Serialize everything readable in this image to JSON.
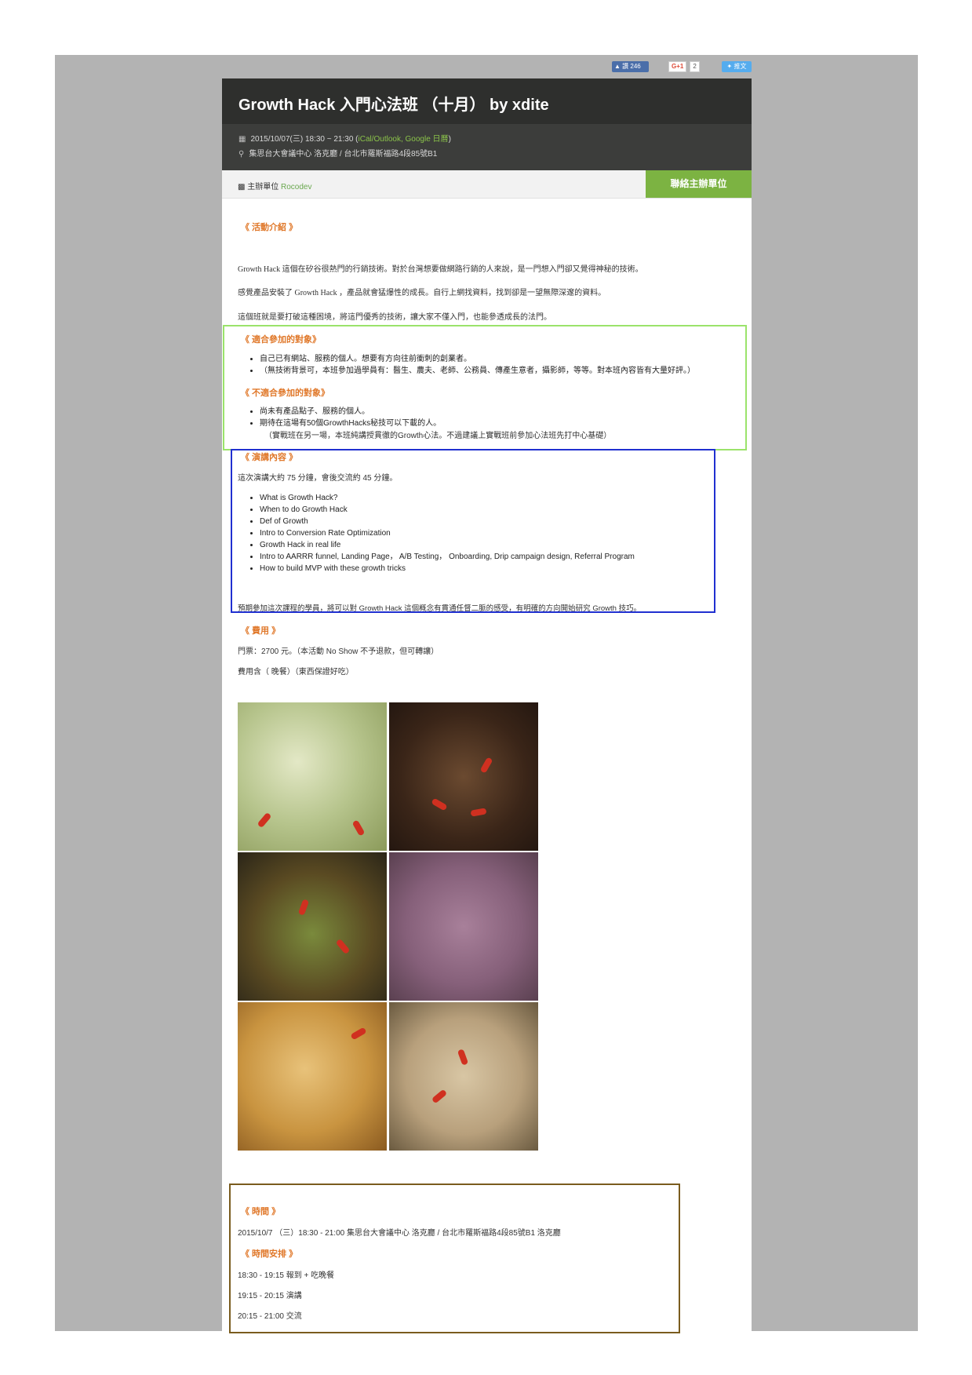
{
  "share": {
    "like_label": "讚 246",
    "gplus_label": "G+1",
    "gplus_count": "2",
    "tweet_label": "推文"
  },
  "event": {
    "title": "Growth Hack 入門心法班 （十月） by xdite",
    "datetime": "2015/10/07(三) 18:30 ~ 21:30 (",
    "calendar_links": "iCal/Outlook, Google 日曆",
    "datetime_close": ")",
    "location": "集思台大會議中心 洛克廳 / 台北市羅斯福路4段85號B1"
  },
  "organizer": {
    "label": "主辦單位",
    "name": "Rocodev",
    "contact_button": "聯絡主辦單位"
  },
  "intro": {
    "heading": "《 活動介紹 》",
    "paragraphs": [
      "Growth Hack 這個在矽谷很熱門的行銷技術。對於台灣想要做網路行銷的人來說，是一門想入門卻又覺得神秘的技術。",
      "感覺產品安裝了 Growth Hack ，產品就會猛爆性的成長。自行上網找資料，找到卻是一望無際深邃的資料。",
      "這個班就是要打破這種困境，將這門優秀的技術，讓大家不僅入門，也能參透成長的法門。"
    ]
  },
  "suitable": {
    "heading": "《 適合參加的對象》",
    "items": [
      "自己已有網站、服務的個人。想要有方向往前衝刺的創業者。",
      "（無技術背景可，本班參加過學員有：醫生、農夫、老師、公務員、傳產生意者，攝影師，等等。對本班內容皆有大量好評。）"
    ]
  },
  "unsuitable": {
    "heading": "《 不適合參加的對象》",
    "items": [
      "尚未有產品點子、服務的個人。",
      "期待在這場有50個GrowthHacks秘技可以下載的人。"
    ],
    "note": "（實戰班在另一場，本班純講授貫徹的Growth心法。不過建議上實戰班前參加心法班先打中心基礎）"
  },
  "talk": {
    "heading": "《 演講內容 》",
    "intro": "這次演講大約 75 分鐘，會後交流約 45 分鐘。",
    "items": [
      "What is Growth Hack?",
      "When to do Growth Hack",
      "Def of Growth",
      "Intro to Conversion Rate Optimization",
      "Growth Hack in real life",
      "Intro to AARRR funnel, Landing Page， A/B Testing， Onboarding, Drip campaign design, Referral Program",
      "How to build MVP with these growth tricks"
    ],
    "outcome": "預期參加這次課程的學員，將可以對 Growth Hack 這個概念有貫通任督二脈的感受，有明確的方向開始研究 Growth 技巧。"
  },
  "fee": {
    "heading": "《 費用 》",
    "ticket": "門票：2700 元。（本活動 No Show 不予退款，但可轉讓）",
    "includes": "費用含（ 晚餐）（東西保證好吃）"
  },
  "food_images": [
    "cabbage-dish",
    "onion-beef-dish",
    "steamed-fish-dish",
    "roast-meat-dish",
    "fried-pork-cutlet",
    "sliced-meat-platter"
  ],
  "time": {
    "heading": "《 時間 》",
    "text": "2015/10/7 （三）18:30 - 21:00  集思台大會議中心 洛克廳 / 台北市羅斯福路4段85號B1 洛克廳"
  },
  "schedule": {
    "heading": "《 時間安排 》",
    "items": [
      "18:30 - 19:15 報到 + 吃晚餐",
      "19:15 - 20:15 演講",
      "20:15 - 21:00 交流"
    ]
  },
  "colors": {
    "header_bg": "#2e2f2d",
    "accent_green": "#7cb342",
    "heading_orange": "#e0782a",
    "frame_gray": "#b3b3b3"
  }
}
